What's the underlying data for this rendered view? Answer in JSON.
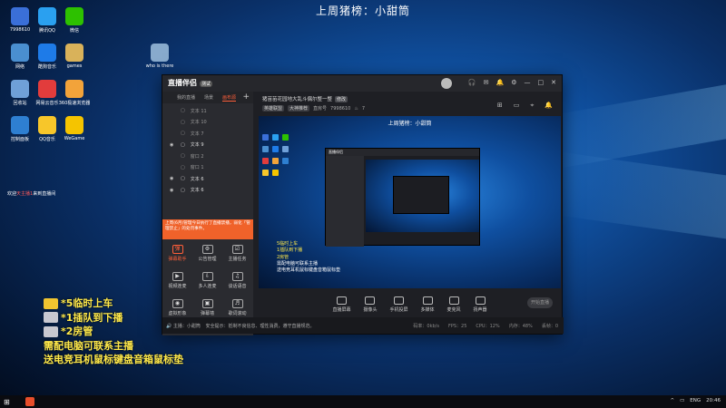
{
  "page_title": "上周猪榜：小甜筒",
  "desktop_icons": [
    {
      "label": "7998610",
      "color": "#3a6fd8"
    },
    {
      "label": "腾讯QQ",
      "color": "#2aa0f0"
    },
    {
      "label": "微信",
      "color": "#2dc100"
    },
    {
      "label": "网络",
      "color": "#4a8fd0"
    },
    {
      "label": "酷狗音乐",
      "color": "#1e7be8"
    },
    {
      "label": "games",
      "color": "#d9b25a"
    },
    {
      "label": "who is there",
      "color": "#88aacc"
    },
    {
      "label": "回收站",
      "color": "#6fa0d8"
    },
    {
      "label": "网易云音乐",
      "color": "#e23c3c"
    },
    {
      "label": "360极速浏览器",
      "color": "#f2a33a"
    },
    {
      "label": "控制面板",
      "color": "#2e7fd1"
    },
    {
      "label": "QQ音乐",
      "color": "#f7c62a"
    },
    {
      "label": "WeGame",
      "color": "#f5c400"
    }
  ],
  "chat": {
    "prefix": "欢迎",
    "name": "天主播1",
    "suffix": "来到直播间"
  },
  "app": {
    "logo": "直播伴侣",
    "version": "测试",
    "titlebar_icons": [
      "🎧",
      "✉",
      "🔔",
      "⚙",
      "—",
      "□",
      "✕"
    ],
    "left_tabs": [
      "我的直播",
      "场景",
      "画布源"
    ],
    "active_tab_index": 2,
    "add_label": "+",
    "sources": [
      {
        "label": "文本 11",
        "visible": false
      },
      {
        "label": "文本 10",
        "visible": false
      },
      {
        "label": "文本 7",
        "visible": false
      },
      {
        "label": "文本 9",
        "visible": true
      },
      {
        "label": "窗口 2",
        "visible": false
      },
      {
        "label": "窗口 1",
        "visible": false
      },
      {
        "label": "文本 6",
        "visible": true
      },
      {
        "label": "文本 6",
        "visible": true
      }
    ],
    "notice": "上周(6月)管理今日执行了直播禁播，弱化「管理禁止」的处罚事件。",
    "tools": [
      {
        "label": "弹幕助手",
        "glyph": "弹",
        "red": true
      },
      {
        "label": "公告管理",
        "glyph": "⚙",
        "red": false
      },
      {
        "label": "主播任务",
        "glyph": "☑",
        "red": false
      },
      {
        "label": "视频连麦",
        "glyph": "▶",
        "red": false
      },
      {
        "label": "多人连麦",
        "glyph": "⇩",
        "red": false
      },
      {
        "label": "谈话语音",
        "glyph": "♫",
        "red": false
      },
      {
        "label": "虚拟形象",
        "glyph": "◉",
        "red": false
      },
      {
        "label": "弹幕墙",
        "glyph": "▣",
        "red": false
      },
      {
        "label": "歌词滚动",
        "glyph": "♬",
        "red": false
      }
    ],
    "room_name": "猪苗苗花园地大乱斗偶尔整一整",
    "room_tag": "修改",
    "room_category": "英雄联盟",
    "room_sub": "大神推荐",
    "room_id_label": "直房号",
    "room_id": "7998610",
    "room_fans": "7",
    "right_icons": [
      "⊞",
      "▭",
      "⌖",
      "🔔"
    ],
    "preview_title": "上周猪榜：小甜筒",
    "overlay_lines": [
      "5临时上车",
      "1插队到下播",
      "2房管",
      "需配电脑可联系主播",
      "送电竞耳机鼠标键盘音箱鼠标垫"
    ],
    "bottom_buttons": [
      "直播屏幕",
      "摄像头",
      "手机投屏",
      "多媒体",
      "麦克风",
      "扬声器"
    ],
    "start_label": "开始直播",
    "status_text": "主播：小甜筒",
    "status_notice": "安全提示：抵制不良信息、理性消费，遵守直播规范。",
    "stats": [
      "码率：0kb/s",
      "FPS：25",
      "CPU：12%",
      "内存：48%",
      "丢帧：0"
    ]
  },
  "left_overlay": [
    {
      "text": "*5临时上车",
      "color": "#f0c430"
    },
    {
      "text": "*1插队到下播",
      "color": "#c8c8d0"
    },
    {
      "text": "*2房管",
      "color": "#c8c8d0"
    },
    {
      "text": "需配电脑可联系主播",
      "color": ""
    },
    {
      "text": "送电竞耳机鼠标键盘音箱鼠标垫",
      "color": ""
    }
  ],
  "taskbar": {
    "start": "⊞",
    "lang": "ENG",
    "time": "20:46"
  }
}
